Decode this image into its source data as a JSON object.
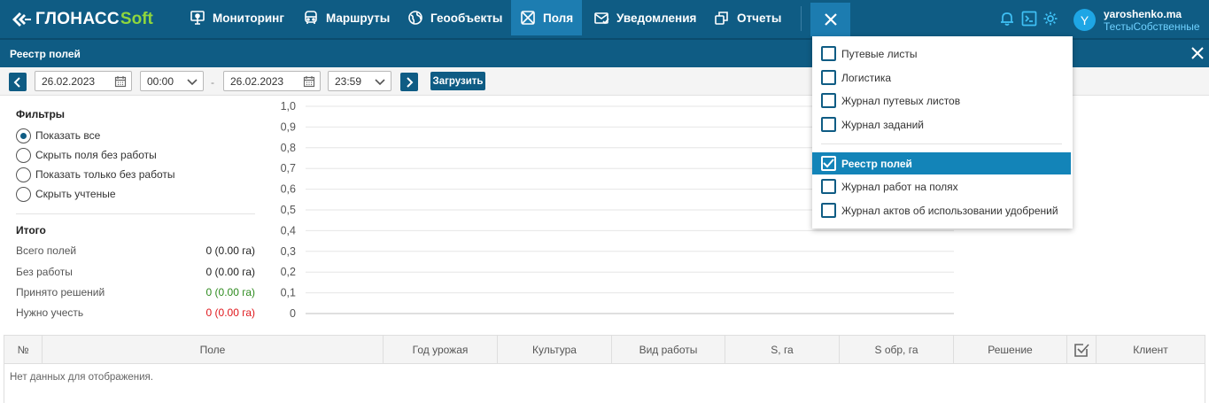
{
  "app": {
    "logo_main": "ГЛОНАСС",
    "logo_accent": "Soft"
  },
  "nav": {
    "items": [
      {
        "label": "Мониторинг",
        "icon": "monitor-icon"
      },
      {
        "label": "Маршруты",
        "icon": "bus-icon"
      },
      {
        "label": "Геообъекты",
        "icon": "globe-icon"
      },
      {
        "label": "Поля",
        "icon": "field-icon",
        "active": true
      },
      {
        "label": "Уведомления",
        "icon": "envelope-icon"
      },
      {
        "label": "Отчеты",
        "icon": "reports-icon"
      }
    ]
  },
  "user": {
    "initial": "Y",
    "name": "yaroshenko.ma",
    "org": "ТестыСобственные"
  },
  "window": {
    "title": "Реестр полей"
  },
  "toolbar": {
    "date_from": "26.02.2023",
    "time_from": "00:00",
    "date_to": "26.02.2023",
    "time_to": "23:59",
    "dash": "-",
    "load_label": "Загрузить"
  },
  "filters": {
    "title": "Фильтры",
    "options": [
      {
        "label": "Показать все",
        "selected": true
      },
      {
        "label": "Скрыть поля без работы",
        "selected": false
      },
      {
        "label": "Показать только без работы",
        "selected": false
      },
      {
        "label": "Скрыть учтеные",
        "selected": false
      }
    ]
  },
  "totals": {
    "title": "Итого",
    "rows": [
      {
        "label": "Всего полей",
        "value": "0 (0.00 га)",
        "color": "#222222"
      },
      {
        "label": "Без работы",
        "value": "0 (0.00 га)",
        "color": "#222222"
      },
      {
        "label": "Принято решений",
        "value": "0 (0.00 га)",
        "color": "#2e8b1f"
      },
      {
        "label": "Нужно учесть",
        "value": "0 (0.00 га)",
        "color": "#e0161b"
      }
    ]
  },
  "chart_data": {
    "type": "bar",
    "categories": [],
    "values": [],
    "ylim": [
      0,
      1
    ],
    "yticks": [
      "1,0",
      "0,9",
      "0,8",
      "0,7",
      "0,6",
      "0,5",
      "0,4",
      "0,3",
      "0,2",
      "0,1",
      "0"
    ],
    "grid": true
  },
  "grid": {
    "columns": [
      {
        "label": "№"
      },
      {
        "label": "Поле"
      },
      {
        "label": "Год урожая"
      },
      {
        "label": "Культура"
      },
      {
        "label": "Вид работы"
      },
      {
        "label": "S, га"
      },
      {
        "label": "S обр, га"
      },
      {
        "label": "Решение"
      },
      {
        "label": "",
        "icon": "check-mark-icon"
      },
      {
        "label": "Клиент"
      }
    ],
    "empty_text": "Нет данных для отображения."
  },
  "menu": {
    "items": [
      {
        "label": "Путевые листы",
        "checked": false
      },
      {
        "label": "Логистика",
        "checked": false
      },
      {
        "label": "Журнал путевых листов",
        "checked": false
      },
      {
        "label": "Журнал заданий",
        "checked": false
      },
      {
        "label": "Реестр полей",
        "checked": true
      },
      {
        "label": "Журнал работ на полях",
        "checked": false
      },
      {
        "label": "Журнал актов об использовании удобрений",
        "checked": false
      }
    ]
  },
  "colors": {
    "header": "#0f5c84",
    "active_tab": "#1d7db1",
    "accent_green": "#8fd63d",
    "menu_selected": "#1384b8"
  }
}
